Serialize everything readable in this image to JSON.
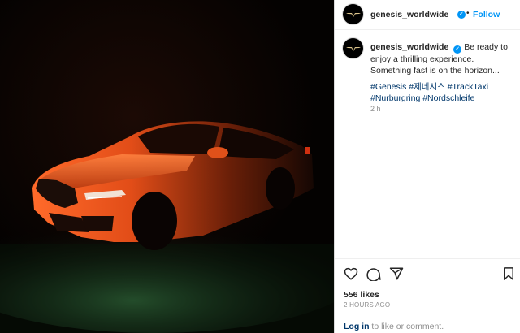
{
  "account": {
    "username": "genesis_worldwide",
    "verified_glyph": "✓",
    "follow_label": "Follow",
    "separator": "•"
  },
  "caption": {
    "text": "Be ready to enjoy a thrilling experience. Something fast is on the horizon...",
    "hashtags": [
      "#Genesis",
      "#제네시스",
      "#TrackTaxi",
      "#Nurburgring",
      "#Nordschleife"
    ],
    "time_ago": "2 h"
  },
  "actions": {
    "icons": [
      "heart-icon",
      "comment-icon",
      "share-icon",
      "bookmark-icon"
    ]
  },
  "stats": {
    "likes": "556 likes",
    "posted": "2 hours ago"
  },
  "footer": {
    "login_label": "Log in",
    "login_suffix": " to like or comment."
  },
  "colors": {
    "accent": "#0095f6",
    "link": "#00376b",
    "car": "#d24a17",
    "ground_glow": "#2f6a3a"
  }
}
